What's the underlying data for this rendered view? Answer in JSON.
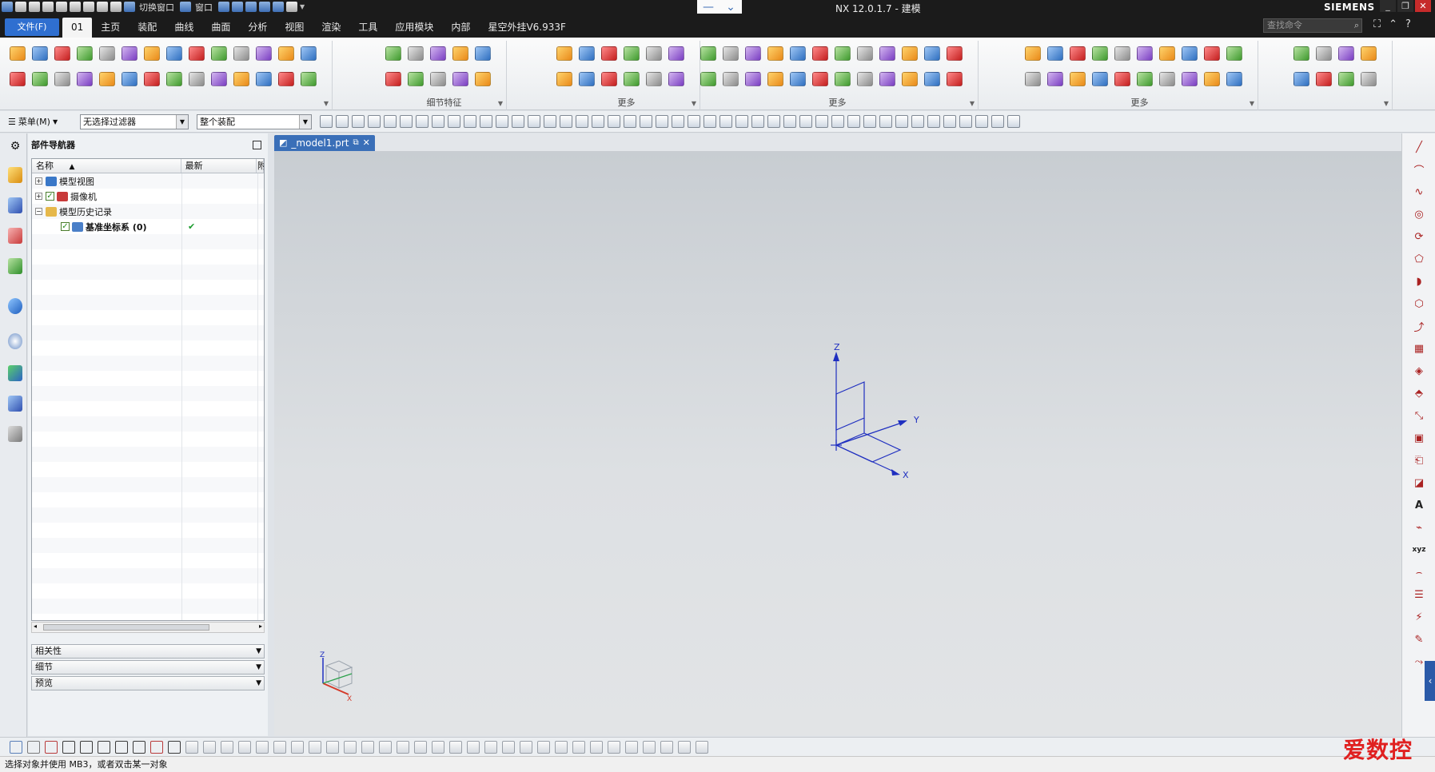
{
  "titlebar": {
    "switch_window": "切换窗口",
    "window_menu": "窗口",
    "app_title": "NX 12.0.1.7 - 建模",
    "brand": "SIEMENS"
  },
  "menubar": {
    "file": "文件(F)",
    "tabs": [
      "01",
      "主页",
      "装配",
      "曲线",
      "曲面",
      "分析",
      "视图",
      "渲染",
      "工具",
      "应用模块",
      "内部",
      "星空外挂V6.933F"
    ],
    "active_tab": "01",
    "search_placeholder": "查找命令"
  },
  "ribbon": {
    "groups": [
      {
        "label": "",
        "cols": 14,
        "rows": 2
      },
      {
        "label": "细节特征",
        "cols": 5,
        "rows": 2
      },
      {
        "label": "更多",
        "cols": 6,
        "rows": 2
      },
      {
        "label": "更多",
        "cols": 12,
        "rows": 2
      },
      {
        "label": "更多",
        "cols": 10,
        "rows": 2
      },
      {
        "label": "",
        "cols": 4,
        "rows": 2
      }
    ]
  },
  "selection_bar": {
    "menu": "菜单(M)",
    "filter": "无选择过滤器",
    "scope": "整个装配"
  },
  "navigator": {
    "title": "部件导航器",
    "col_name": "名称",
    "col_latest": "最新",
    "col_extra": "附",
    "nodes": [
      {
        "label": "模型视图",
        "expander": "+",
        "latest": "",
        "color": "#3a78c8",
        "check": false,
        "level": 0
      },
      {
        "label": "摄像机",
        "expander": "+",
        "latest": "",
        "color": "#c83a3a",
        "check": true,
        "level": 0
      },
      {
        "label": "模型历史记录",
        "expander": "−",
        "latest": "",
        "color": "#e6b84a",
        "check": false,
        "level": 0
      },
      {
        "label": "基准坐标系 (0)",
        "expander": "",
        "latest": "✔",
        "color": "#4a7fc8",
        "check": true,
        "level": 1
      }
    ],
    "panels": [
      "相关性",
      "细节",
      "预览"
    ]
  },
  "document": {
    "tab_label": "_model1.prt"
  },
  "triad": {
    "x": "X",
    "y": "Y",
    "z": "Z"
  },
  "status": {
    "message": "选择对象并使用 MB3，或者双击某一对象"
  },
  "watermark": "爱数控",
  "colors": {
    "accent": "#2f6fd0",
    "datum_csys": "#1f2fc0",
    "check_green": "#1a9b2c"
  }
}
